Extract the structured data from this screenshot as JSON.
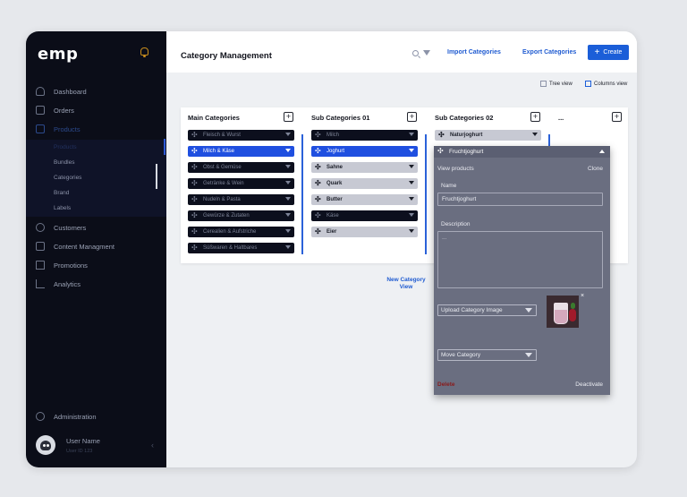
{
  "app": {
    "logo": "emp"
  },
  "sidebar": {
    "items": [
      {
        "label": "Dashboard"
      },
      {
        "label": "Orders"
      },
      {
        "label": "Products"
      },
      {
        "label": "Customers"
      },
      {
        "label": "Content Managment"
      },
      {
        "label": "Promotions"
      },
      {
        "label": "Analytics"
      },
      {
        "label": "Administration"
      }
    ],
    "sub_items": [
      {
        "label": "Products"
      },
      {
        "label": "Bundles"
      },
      {
        "label": "Categories"
      },
      {
        "label": "Brand"
      },
      {
        "label": "Labels"
      }
    ],
    "user": {
      "name": "User Name",
      "sub": "User ID 123"
    }
  },
  "header": {
    "title": "Category Management",
    "import_label": "Import Categories",
    "export_label": "Export Categories",
    "create_label": "Create"
  },
  "views": {
    "tree_label": "Tree view",
    "columns_label": "Columns view"
  },
  "board": {
    "columns": [
      {
        "title": "Main Categories",
        "chips": [
          {
            "label": "Fleisch & Wurst",
            "state": "dark"
          },
          {
            "label": "Milch & Käse",
            "state": "selected"
          },
          {
            "label": "Obst & Gemüse",
            "state": "dark"
          },
          {
            "label": "Getränke & Wein",
            "state": "dark"
          },
          {
            "label": "Nudeln & Pasta",
            "state": "dark"
          },
          {
            "label": "Gewürze & Zutaten",
            "state": "dark"
          },
          {
            "label": "Cerealien & Aufstriche",
            "state": "dark"
          },
          {
            "label": "Süßwaren & Haltbares",
            "state": "dark"
          }
        ]
      },
      {
        "title": "Sub Categories 01",
        "chips": [
          {
            "label": "Milch",
            "state": "dark"
          },
          {
            "label": "Joghurt",
            "state": "selected"
          },
          {
            "label": "Sahne",
            "state": "grey"
          },
          {
            "label": "Quark",
            "state": "grey"
          },
          {
            "label": "Butter",
            "state": "grey"
          },
          {
            "label": "Käse",
            "state": "dark"
          },
          {
            "label": "Eier",
            "state": "grey"
          }
        ]
      },
      {
        "title": "Sub Categories 02",
        "chips": [
          {
            "label": "Naturjoghurt",
            "state": "grey"
          }
        ]
      },
      {
        "title": "...",
        "chips": []
      }
    ],
    "new_view_label": "New Category View"
  },
  "popup": {
    "title": "Fruchtjoghurt",
    "view_products": "View products",
    "clone": "Clone",
    "name_label": "Name",
    "name_value": "Fruchtjoghurt",
    "description_label": "Description",
    "description_placeholder": "...",
    "upload_label": "Upload Category Image",
    "move_label": "Move Category",
    "delete_label": "Delete",
    "deactivate_label": "Deactivate",
    "close_glyph": "×"
  },
  "colors": {
    "sidebar_bg": "#0b0d18",
    "accent": "#1b5ed8",
    "selected_chip": "#1f4fe0",
    "danger": "#8a1a1a"
  },
  "icons": {
    "grip": "✣",
    "plus": "+"
  }
}
